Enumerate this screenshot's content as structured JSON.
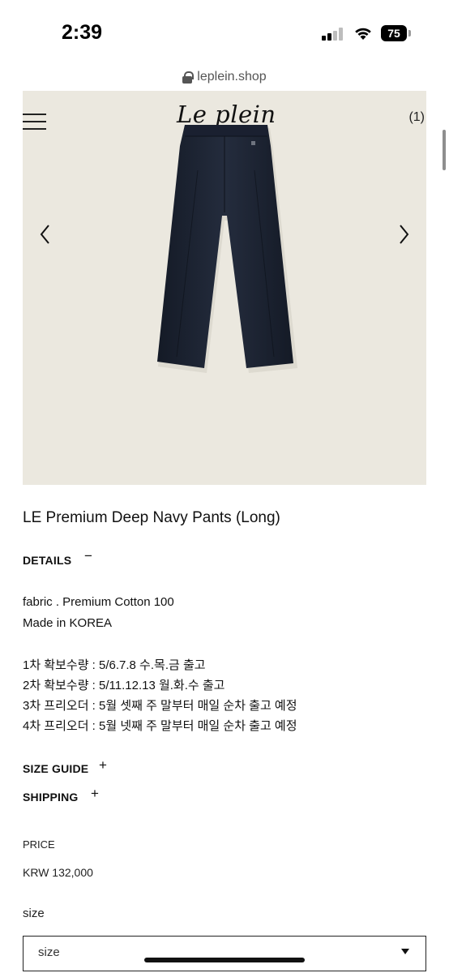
{
  "status": {
    "time": "2:39",
    "battery": "75"
  },
  "browser": {
    "url": "leplein.shop"
  },
  "header": {
    "logo": "Le plein",
    "cart": "(1)"
  },
  "product": {
    "title": "LE Premium Deep Navy Pants (Long)",
    "color": "#1b2130"
  },
  "details": {
    "heading": "DETAILS",
    "toggle": "−",
    "lines": [
      "fabric . Premium Cotton 100",
      "Made in KOREA",
      "1차 확보수량 : 5/6.7.8 수.목.금 출고",
      "2차 확보수량 : 5/11.12.13 월.화.수 출고",
      "3차 프리오더 : 5월 셋째 주 말부터 매일 순차 출고 예정",
      "4차 프리오더 : 5월 넷째 주 말부터 매일 순차 출고 예정"
    ]
  },
  "size_guide": {
    "heading": "SIZE GUIDE",
    "toggle": "+"
  },
  "shipping": {
    "heading": "SHIPPING",
    "toggle": "+"
  },
  "price": {
    "label": "PRICE",
    "value": "KRW 132,000"
  },
  "size": {
    "label": "size",
    "selected": "size"
  }
}
